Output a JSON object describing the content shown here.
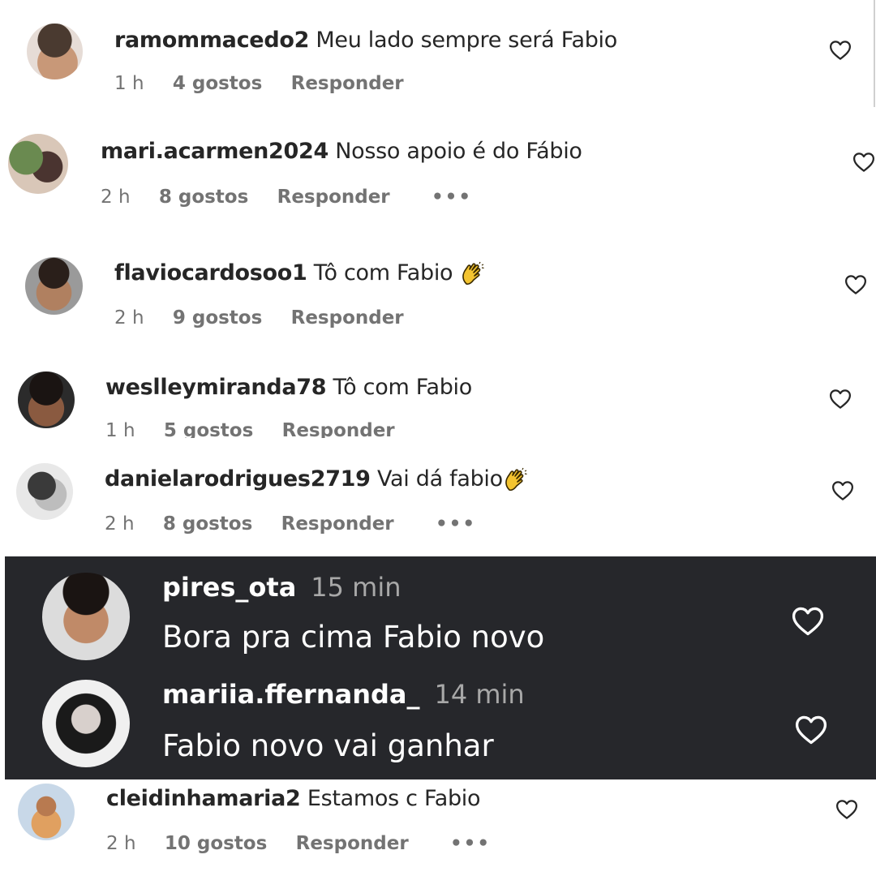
{
  "comments": [
    {
      "username": "ramommacedo2",
      "text": "Meu lado sempre será Fabio",
      "time": "1 h",
      "likes": "4 gostos",
      "reply": "Responder",
      "more": ""
    },
    {
      "username": "mari.acarmen2024",
      "text": "Nosso apoio é do Fábio",
      "time": "2 h",
      "likes": "8 gostos",
      "reply": "Responder",
      "more": "•••"
    },
    {
      "username": "flaviocardosoo1",
      "text": "Tô com Fabio",
      "time": "2 h",
      "likes": "9 gostos",
      "reply": "Responder",
      "more": ""
    },
    {
      "username": "weslleymiranda78",
      "text": "Tô com Fabio",
      "time": "1 h",
      "likes": "5 gostos",
      "reply": "Responder",
      "more": ""
    },
    {
      "username": "danielarodrigues2719",
      "text": "Vai dá fabio",
      "time": "2 h",
      "likes": "8 gostos",
      "reply": "Responder",
      "more": "•••"
    },
    {
      "username": "cleidinhamaria2",
      "text": "Estamos c Fabio",
      "time": "2 h",
      "likes": "10 gostos",
      "reply": "Responder",
      "more": "•••"
    }
  ],
  "dark_comments": [
    {
      "username": "pires_ota",
      "time": "15 min",
      "text": "Bora pra cima Fabio novo"
    },
    {
      "username": "mariia.ffernanda_",
      "time": "14 min",
      "text": "Fabio novo vai ganhar"
    }
  ],
  "icons": {
    "like": "heart-icon",
    "reaction": "clapping-hands-emoji",
    "more": "more-options-icon"
  },
  "colors": {
    "text": "#262626",
    "meta": "#737373",
    "dark_bg": "#26272b",
    "dark_text": "#ffffff",
    "dark_time": "#a8a8a8"
  }
}
